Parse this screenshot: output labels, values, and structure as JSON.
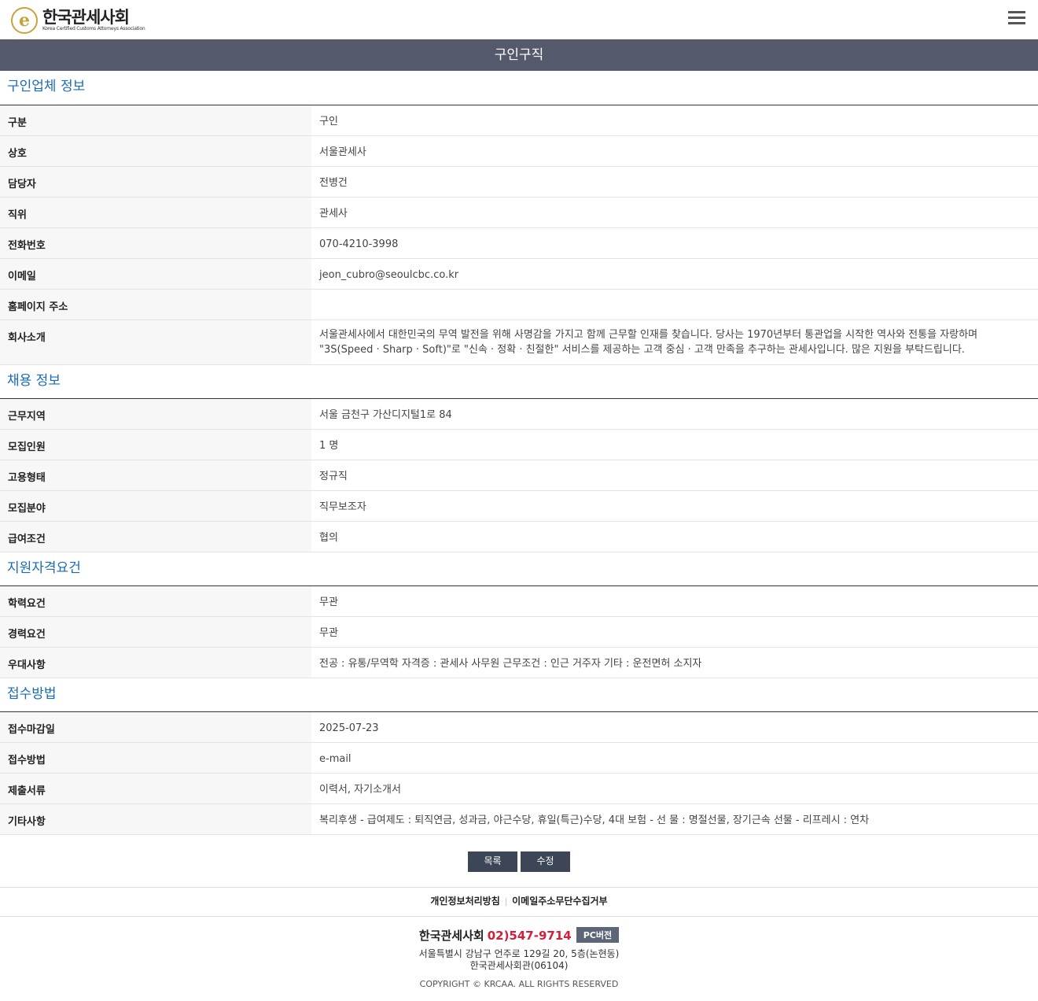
{
  "header": {
    "logo_ko": "한국관세사회",
    "logo_en": "Korea Certified Customs Attorneys Association",
    "logo_mark": "e"
  },
  "title_bar": "구인구직",
  "sections": {
    "company": {
      "title": "구인업체 정보",
      "rows": [
        {
          "label": "구분",
          "value": "구인"
        },
        {
          "label": "상호",
          "value": "서울관세사"
        },
        {
          "label": "담당자",
          "value": "전병건"
        },
        {
          "label": "직위",
          "value": "관세사"
        },
        {
          "label": "전화번호",
          "value": "070-4210-3998"
        },
        {
          "label": "이메일",
          "value": "jeon_cubro@seoulcbc.co.kr"
        },
        {
          "label": "홈페이지 주소",
          "value": ""
        },
        {
          "label": "회사소개",
          "value_line1": "서울관세사에서 대한민국의 무역 발전을 위해 사명감을 가지고 함께 근무할 인재를 찾습니다. 당사는 1970년부터 통관업을 시작한 역사와 전통을 자랑하며",
          "value_line2": "\"3S(Speed · Sharp · Soft)\"로 \"신속 · 정확 · 친절한\" 서비스를 제공하는 고객 중심 · 고객 만족을 추구하는 관세사입니다. 많은 지원을 부탁드립니다."
        }
      ]
    },
    "recruit": {
      "title": "채용 정보",
      "rows": [
        {
          "label": "근무지역",
          "value": "서울 금천구 가산디지털1로 84"
        },
        {
          "label": "모집인원",
          "value": "1 명"
        },
        {
          "label": "고용형태",
          "value": "정규직"
        },
        {
          "label": "모집분야",
          "value": "직무보조자"
        },
        {
          "label": "급여조건",
          "value": "협의"
        }
      ]
    },
    "qualification": {
      "title": "지원자격요건",
      "rows": [
        {
          "label": "학력요건",
          "value": "무관"
        },
        {
          "label": "경력요건",
          "value": "무관"
        },
        {
          "label": "우대사항",
          "value": "전공 : 유통/무역학 자격증 : 관세사 사무원 근무조건 : 인근 거주자 기타 : 운전면허 소지자"
        }
      ]
    },
    "application": {
      "title": "접수방법",
      "rows": [
        {
          "label": "접수마감일",
          "value": "2025-07-23"
        },
        {
          "label": "접수방법",
          "value": "e-mail"
        },
        {
          "label": "제출서류",
          "value": "이력서, 자기소개서"
        },
        {
          "label": "기타사항",
          "value": "복리후생 - 급여제도 : 퇴직연금, 성과금, 야근수당, 휴일(특근)수당, 4대 보험 - 선 물 : 명절선물, 장기근속 선물 - 리프레시 : 연차"
        }
      ]
    }
  },
  "buttons": {
    "list": "목록",
    "edit": "수정"
  },
  "policy": {
    "privacy": "개인정보처리방침",
    "email": "이메일주소무단수집거부"
  },
  "footer": {
    "org": "한국관세사회",
    "tel": "02)547-9714",
    "pc": "PC버전",
    "addr1": "서울특별시 강남구 언주로 129길 20, 5층(논현동)",
    "addr2": "한국관세사회관(06104)",
    "copyright": "COPYRIGHT © KRCAA. ALL RIGHTS RESERVED"
  },
  "colors": {
    "title_bar": "#545a6c",
    "section_title": "#1a6bb8",
    "button": "#3d4656",
    "tel": "#d0203b",
    "logo_gold": "#c7a33a"
  }
}
